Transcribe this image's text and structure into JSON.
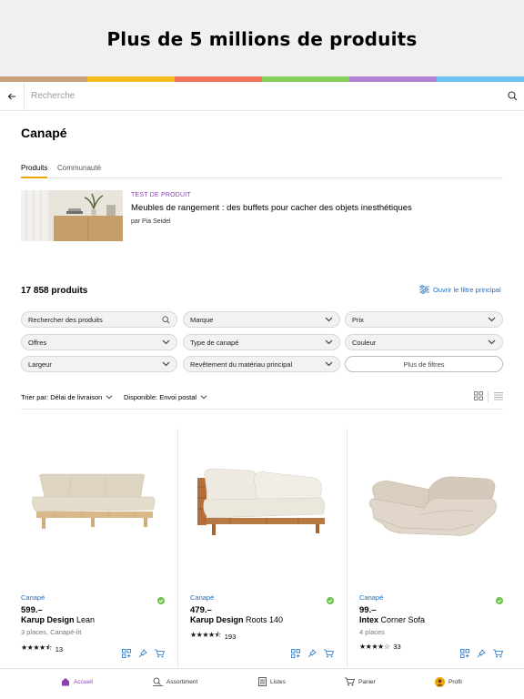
{
  "promo": {
    "headline": "Plus de 5 millions de produits"
  },
  "stripe_colors": [
    "#c8a27a",
    "#f5bd1f",
    "#f07358",
    "#86cf5b",
    "#b482d3",
    "#6ec3ef"
  ],
  "search": {
    "placeholder": "Recherche",
    "back_icon": "arrow-left-icon",
    "search_icon": "search-icon"
  },
  "page": {
    "title": "Canapé"
  },
  "tabs": [
    {
      "label": "Produits",
      "active": true
    },
    {
      "label": "Communauté",
      "active": false
    }
  ],
  "article": {
    "kicker": "TEST DE PRODUIT",
    "title": "Meubles de rangement : des buffets pour cacher des objets inesthétiques",
    "author": "par Pia Seidel"
  },
  "results": {
    "count": "17 858 produits",
    "filter_link": "Ouvrir le filtre principal"
  },
  "filters": {
    "search": "Rechercher des produits",
    "marque": "Marque",
    "prix": "Prix",
    "offres": "Offres",
    "type": "Type de canapé",
    "couleur": "Couleur",
    "largeur": "Largeur",
    "revetement": "Revêtement du matériau principal",
    "more": "Plus de filtres"
  },
  "sort": {
    "sort_label": "Trier par: Délai de livraison",
    "availability": "Disponible: Envoi postal"
  },
  "products": [
    {
      "category": "Canapé",
      "price": "599.–",
      "brand": "Karup Design",
      "model": " Lean",
      "desc": "3 places, Canapé-lit",
      "stars": "★★★★⯪",
      "reviews": "13"
    },
    {
      "category": "Canapé",
      "price": "479.–",
      "brand": "Karup Design",
      "model": " Roots 140",
      "desc": "",
      "stars": "★★★★⯪",
      "reviews": "193"
    },
    {
      "category": "Canapé",
      "price": "99.–",
      "brand": "Intex",
      "model": " Corner Sofa",
      "desc": "4 places",
      "stars": "★★★★☆",
      "reviews": "33"
    }
  ],
  "nav": [
    {
      "label": "Accueil",
      "icon": "home-icon"
    },
    {
      "label": "Assortiment",
      "icon": "assortment-icon"
    },
    {
      "label": "Listes",
      "icon": "list-icon"
    },
    {
      "label": "Panier",
      "icon": "cart-icon"
    },
    {
      "label": "Profil",
      "icon": "profile-avatar-icon"
    }
  ],
  "colors": {
    "accent_purple": "#8a3fb4",
    "link_blue": "#1a6ec6",
    "tab_underline": "#f0a800",
    "availability_green": "#6cc24a"
  }
}
